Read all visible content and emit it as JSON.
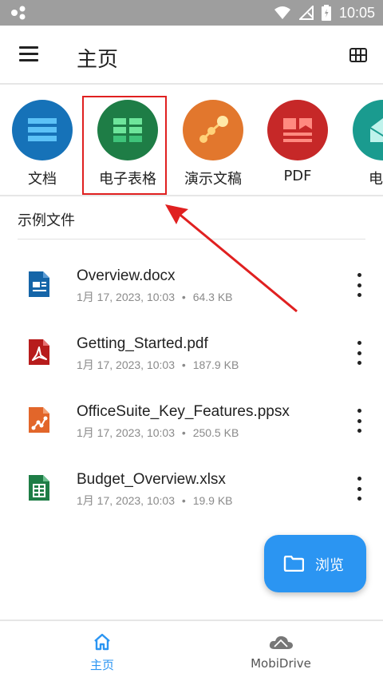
{
  "status_bar": {
    "time": "10:05"
  },
  "app_bar": {
    "title": "主页"
  },
  "categories": [
    {
      "label": "文档",
      "icon": "document-icon",
      "color": "#1672b8"
    },
    {
      "label": "电子表格",
      "icon": "spreadsheet-icon",
      "color": "#1e7d46"
    },
    {
      "label": "演示文稿",
      "icon": "presentation-icon",
      "color": "#e2772d"
    },
    {
      "label": "PDF",
      "icon": "pdf-icon",
      "color": "#c62828"
    },
    {
      "label": "电子",
      "icon": "email-icon",
      "color": "#1a9b8f"
    }
  ],
  "section": {
    "title": "示例文件"
  },
  "files": [
    {
      "name": "Overview.docx",
      "date": "1月 17, 2023, 10:03",
      "size": "64.3 KB",
      "icon": "docx-file-icon",
      "color": "#1565a8"
    },
    {
      "name": "Getting_Started.pdf",
      "date": "1月 17, 2023, 10:03",
      "size": "187.9 KB",
      "icon": "pdf-file-icon",
      "color": "#b71c1c"
    },
    {
      "name": "OfficeSuite_Key_Features.ppsx",
      "date": "1月 17, 2023, 10:03",
      "size": "250.5 KB",
      "icon": "ppsx-file-icon",
      "color": "#e2662a"
    },
    {
      "name": "Budget_Overview.xlsx",
      "date": "1月 17, 2023, 10:03",
      "size": "19.9 KB",
      "icon": "xlsx-file-icon",
      "color": "#1e7d46"
    }
  ],
  "meta_separator": "•",
  "fab": {
    "label": "浏览"
  },
  "bottom_nav": [
    {
      "label": "主页",
      "active": true,
      "color": "#2b95f2"
    },
    {
      "label": "MobiDrive",
      "active": false,
      "color": "#555555"
    }
  ],
  "accent_color": "#2b95f2",
  "highlight_color": "#e02020"
}
